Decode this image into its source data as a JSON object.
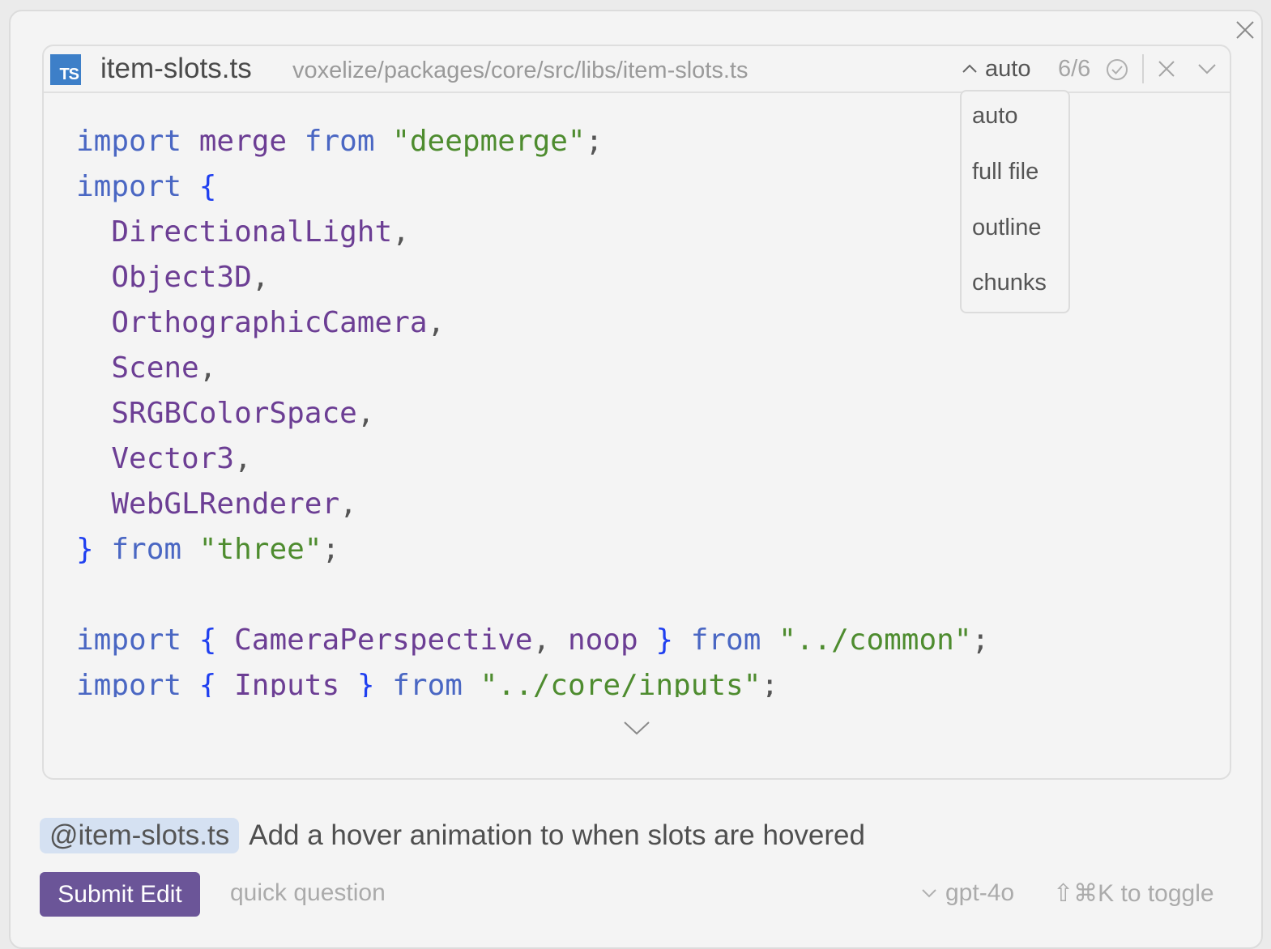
{
  "panel": {
    "close_icon": "close-icon"
  },
  "file": {
    "icon_label": "TS",
    "name": "item-slots.ts",
    "path": "voxelize/packages/core/src/libs/item-slots.ts"
  },
  "header": {
    "mode_selected": "auto",
    "mode_chevron_icon": "chevron-up-icon",
    "counter": "6/6",
    "check_icon": "check-circle-icon",
    "close_icon": "close-icon",
    "collapse_icon": "chevron-down-icon"
  },
  "mode_dropdown": {
    "options": [
      "auto",
      "full file",
      "outline",
      "chunks"
    ]
  },
  "code": {
    "lines": [
      [
        [
          "kw",
          "import"
        ],
        [
          "pn",
          " "
        ],
        [
          "id",
          "merge"
        ],
        [
          "pn",
          " "
        ],
        [
          "kw",
          "from"
        ],
        [
          "pn",
          " "
        ],
        [
          "str",
          "\"deepmerge\""
        ],
        [
          "pn",
          ";"
        ]
      ],
      [
        [
          "kw",
          "import"
        ],
        [
          "pn",
          " "
        ],
        [
          "br",
          "{"
        ]
      ],
      [
        [
          "pn",
          "  "
        ],
        [
          "id",
          "DirectionalLight"
        ],
        [
          "pn",
          ","
        ]
      ],
      [
        [
          "pn",
          "  "
        ],
        [
          "id",
          "Object3D"
        ],
        [
          "pn",
          ","
        ]
      ],
      [
        [
          "pn",
          "  "
        ],
        [
          "id",
          "OrthographicCamera"
        ],
        [
          "pn",
          ","
        ]
      ],
      [
        [
          "pn",
          "  "
        ],
        [
          "id",
          "Scene"
        ],
        [
          "pn",
          ","
        ]
      ],
      [
        [
          "pn",
          "  "
        ],
        [
          "id",
          "SRGBColorSpace"
        ],
        [
          "pn",
          ","
        ]
      ],
      [
        [
          "pn",
          "  "
        ],
        [
          "id",
          "Vector3"
        ],
        [
          "pn",
          ","
        ]
      ],
      [
        [
          "pn",
          "  "
        ],
        [
          "id",
          "WebGLRenderer"
        ],
        [
          "pn",
          ","
        ]
      ],
      [
        [
          "br",
          "}"
        ],
        [
          "pn",
          " "
        ],
        [
          "kw",
          "from"
        ],
        [
          "pn",
          " "
        ],
        [
          "str",
          "\"three\""
        ],
        [
          "pn",
          ";"
        ]
      ],
      [],
      [
        [
          "kw",
          "import"
        ],
        [
          "pn",
          " "
        ],
        [
          "br",
          "{"
        ],
        [
          "pn",
          " "
        ],
        [
          "id",
          "CameraPerspective"
        ],
        [
          "pn",
          ", "
        ],
        [
          "id",
          "noop"
        ],
        [
          "pn",
          " "
        ],
        [
          "br",
          "}"
        ],
        [
          "pn",
          " "
        ],
        [
          "kw",
          "from"
        ],
        [
          "pn",
          " "
        ],
        [
          "str",
          "\"../common\""
        ],
        [
          "pn",
          ";"
        ]
      ],
      [
        [
          "kw",
          "import"
        ],
        [
          "pn",
          " "
        ],
        [
          "br",
          "{"
        ],
        [
          "pn",
          " "
        ],
        [
          "id",
          "Inputs"
        ],
        [
          "pn",
          " "
        ],
        [
          "br",
          "}"
        ],
        [
          "pn",
          " "
        ],
        [
          "kw",
          "from"
        ],
        [
          "pn",
          " "
        ],
        [
          "str",
          "\"../core/inputs\""
        ],
        [
          "pn",
          ";"
        ]
      ]
    ],
    "expand_icon": "chevron-down-icon"
  },
  "prompt": {
    "mention": "@item-slots.ts",
    "text": "Add a hover animation to when slots are hovered"
  },
  "footer": {
    "submit_label": "Submit Edit",
    "quick_question_label": "quick question",
    "model": "gpt-4o",
    "toggle_hint": "⇧⌘K to toggle"
  },
  "colors": {
    "submit_bg": "#6b5598",
    "mention_bg": "#d5e1f2",
    "ts_icon": "#3d7fc8",
    "keyword": "#4a67c3",
    "identifier": "#6c3e94",
    "string": "#4e8c2f",
    "brace": "#1f3ff0"
  }
}
